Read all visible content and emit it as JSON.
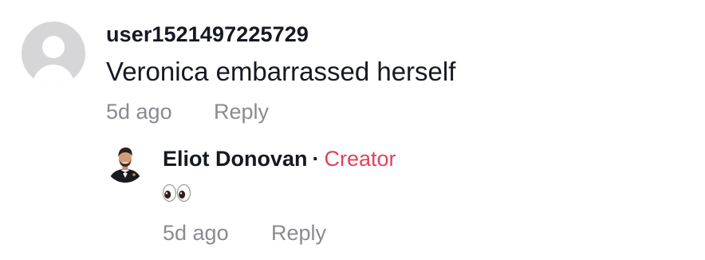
{
  "comment": {
    "avatar_icon": "default-user-avatar-icon",
    "username": "user1521497225729",
    "text": "Veronica embarrassed herself",
    "time": "5d ago",
    "reply_label": "Reply"
  },
  "reply": {
    "avatar_icon": "creator-avatar-icon",
    "author": "Eliot Donovan",
    "separator": "·",
    "badge": "Creator",
    "emoji_icon": "eyes-emoji-icon",
    "text": "👀",
    "time": "5d ago",
    "reply_label": "Reply"
  },
  "colors": {
    "text_primary": "#161823",
    "text_secondary": "#8a8b91",
    "creator_accent": "#e0435c",
    "avatar_placeholder": "#d6d6d8"
  }
}
